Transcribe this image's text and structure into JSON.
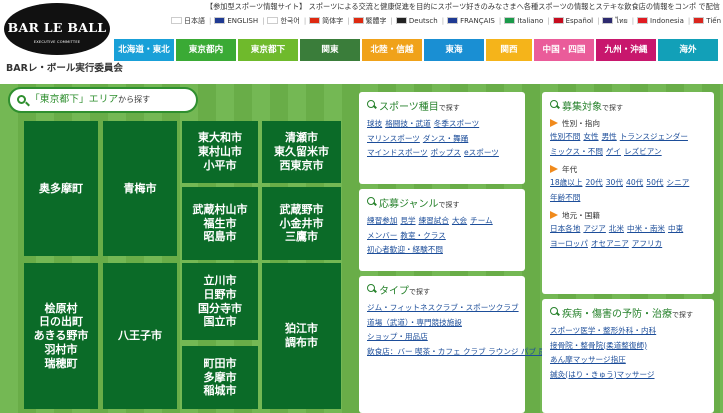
{
  "logo": {
    "title": "BAR LE BALL",
    "sub": "EXECUTIVE COMMITTEE"
  },
  "org_name": "BARレ・ボール実行委員会",
  "tagline": "【参加型スポーツ情報サイト】 スポーツによる交流と健康促進を目的にスポーツ好きのみなさまへ各種スポーツの情報とステキな飲食店の情報をコンポ で配信",
  "languages": [
    {
      "label": "日本語",
      "color": "#ffffff"
    },
    {
      "label": "ENGLISH",
      "color": "#1f3a93"
    },
    {
      "label": "한국어",
      "color": "#ffffff"
    },
    {
      "label": "简体字",
      "color": "#de2910"
    },
    {
      "label": "繁體字",
      "color": "#de2910"
    },
    {
      "label": "Deutsch",
      "color": "#222222"
    },
    {
      "label": "FRANÇAIS",
      "color": "#1f3a93"
    },
    {
      "label": "Italiano",
      "color": "#1a9a4a"
    },
    {
      "label": "Español",
      "color": "#c60b1e"
    },
    {
      "label": "ไทย",
      "color": "#2d2a6f"
    },
    {
      "label": "Indonesia",
      "color": "#e11b22"
    },
    {
      "label": "Tiếng Việt",
      "color": "#da251d"
    },
    {
      "label": "العربية",
      "color": "#1a7a3a"
    }
  ],
  "tabs": [
    {
      "label": "北海道・東北",
      "color": "#19a0d8"
    },
    {
      "label": "東京都内",
      "color": "#3aaa35"
    },
    {
      "label": "東京都下",
      "color": "#6fba2c"
    },
    {
      "label": "関東",
      "color": "#3a7d3a"
    },
    {
      "label": "北陸・信越",
      "color": "#f0a21a"
    },
    {
      "label": "東海",
      "color": "#1a8fd3"
    },
    {
      "label": "関西",
      "color": "#f5b41a"
    },
    {
      "label": "中国・四国",
      "color": "#ea5c9a"
    },
    {
      "label": "九州・沖縄",
      "color": "#c8176d"
    },
    {
      "label": "海外",
      "color": "#12a0b8"
    }
  ],
  "search_label": {
    "main": "「東京都下」エリア",
    "suffix": "から探す"
  },
  "areas": [
    {
      "name": "area-okutama",
      "lines": [
        "奥多摩町"
      ]
    },
    {
      "name": "area-ome",
      "lines": [
        "青梅市"
      ]
    },
    {
      "name": "area-higashiyamato",
      "lines": [
        "東大和市",
        "東村山市",
        "小平市"
      ]
    },
    {
      "name": "area-kiyose",
      "lines": [
        "清瀬市",
        "東久留米市",
        "西東京市"
      ]
    },
    {
      "name": "area-musashimurayama",
      "lines": [
        "武蔵村山市",
        "福生市",
        "昭島市"
      ]
    },
    {
      "name": "area-musashino",
      "lines": [
        "武蔵野市",
        "小金井市",
        "三鷹市"
      ]
    },
    {
      "name": "area-hinohara",
      "lines": [
        "桧原村",
        "日の出町",
        "あきる野市",
        "羽村市",
        "瑞穂町"
      ]
    },
    {
      "name": "area-hachioji",
      "lines": [
        "八王子市"
      ]
    },
    {
      "name": "area-tachikawa",
      "lines": [
        "立川市",
        "日野市",
        "国分寺市",
        "国立市"
      ]
    },
    {
      "name": "area-komae",
      "lines": [
        "狛江市",
        "調布市"
      ]
    },
    {
      "name": "area-machida",
      "lines": [
        "町田市",
        "多摩市",
        "稲城市"
      ]
    }
  ],
  "panels": {
    "sports": {
      "title": "スポーツ種目",
      "suffix": "で探す",
      "links": [
        "球技",
        "格闘技・武道",
        "冬季スポーツ",
        "マリンスポーツ",
        "ダンス・舞踊",
        "マインドスポーツ",
        "ポップス",
        "eスポーツ"
      ]
    },
    "genre": {
      "title": "応募ジャンル",
      "suffix": "で探す",
      "links": [
        "練習参加",
        "見学",
        "練習試合",
        "大会",
        "チーム",
        "メンバー",
        "教室・クラス",
        "初心者歓迎・経験不問"
      ]
    },
    "type": {
      "title": "タイプ",
      "suffix": "で探す",
      "links": [
        "ジム・フィットネスクラブ・スポーツクラブ",
        "道場（武道）・専門競技施設",
        "ショップ・用品店",
        "飲食店：バー 喫茶・カフェ クラブ ラウンジ パブ 居酒屋"
      ]
    },
    "target": {
      "title": "募集対象",
      "suffix": "で探す",
      "groups": [
        {
          "label": "性別・指向",
          "links": [
            "性別不問",
            "女性",
            "男性",
            "トランスジェンダー",
            "ミックス・不問",
            "ゲイ",
            "レズビアン"
          ]
        },
        {
          "label": "年代",
          "links": [
            "18歳以上",
            "20代",
            "30代",
            "40代",
            "50代",
            "シニア",
            "年齢不問"
          ]
        },
        {
          "label": "地元・国籍",
          "links": [
            "日本各地",
            "アジア",
            "北米",
            "中米・南米",
            "中東",
            "ヨーロッパ",
            "オセアニア",
            "アフリカ"
          ]
        }
      ]
    },
    "disease": {
      "title": "疾病・傷害の予防・治療",
      "suffix": "で探す",
      "links": [
        "スポーツ医学・整形外科・内科",
        "接骨院・整骨院(柔道整復師)",
        "あん摩マッサージ指圧",
        "鍼灸(はり・きゅう)マッサージ"
      ]
    }
  }
}
